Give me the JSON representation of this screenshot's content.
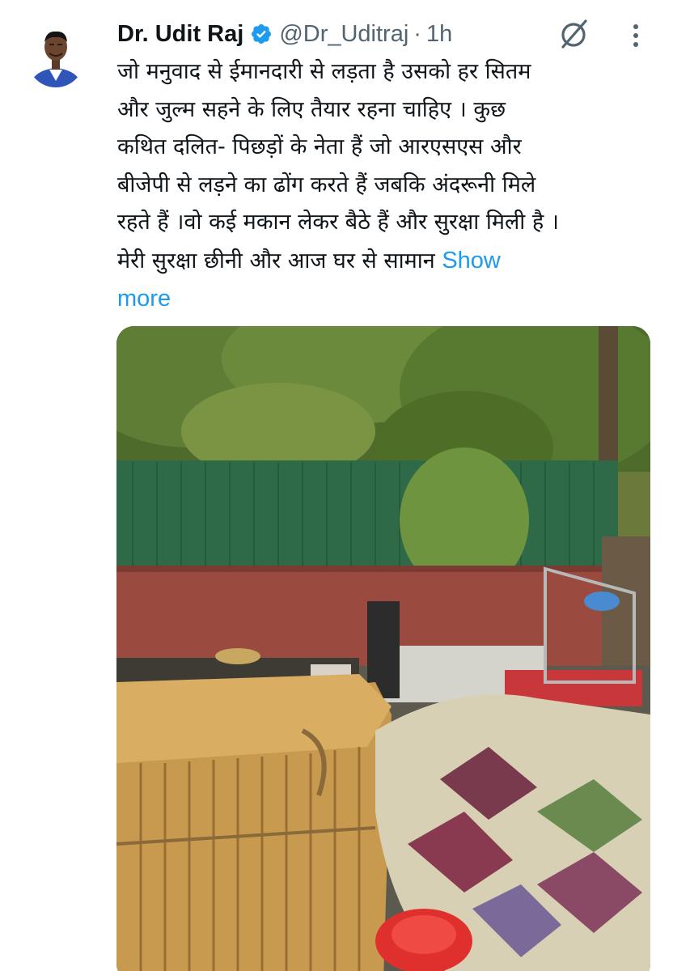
{
  "author": {
    "display_name": "Dr. Udit Raj",
    "handle": "@Dr_Uditraj",
    "separator": "·",
    "timestamp": "1h",
    "avatar_icon": "profile-photo",
    "verified_icon": "verified-badge-icon",
    "verified_color": "#1d9bf0"
  },
  "actions": {
    "grok_icon": "grok-icon",
    "more_icon": "more-options-icon"
  },
  "tweet": {
    "lines": [
      "जो मनुवाद से ईमानदारी से लड़ता है उसको हर सितम",
      "और जुल्म सहने के लिए तैयार रहना चाहिए । कुछ",
      "कथित दलित- पिछड़ों के नेता हैं जो आरएसएस और",
      "बीजेपी से लड़ने का ढोंग करते हैं जबकि अंदरूनी मिले",
      "रहते हैं ।वो कई मकान लेकर बैठे हैं और सुरक्षा मिली है ।",
      "मेरी सुरक्षा छीनी और आज घर से सामान "
    ],
    "show_more_first": "Show",
    "show_more_second": "more",
    "link_color": "#1d9bf0"
  },
  "media": {
    "type": "photo"
  }
}
